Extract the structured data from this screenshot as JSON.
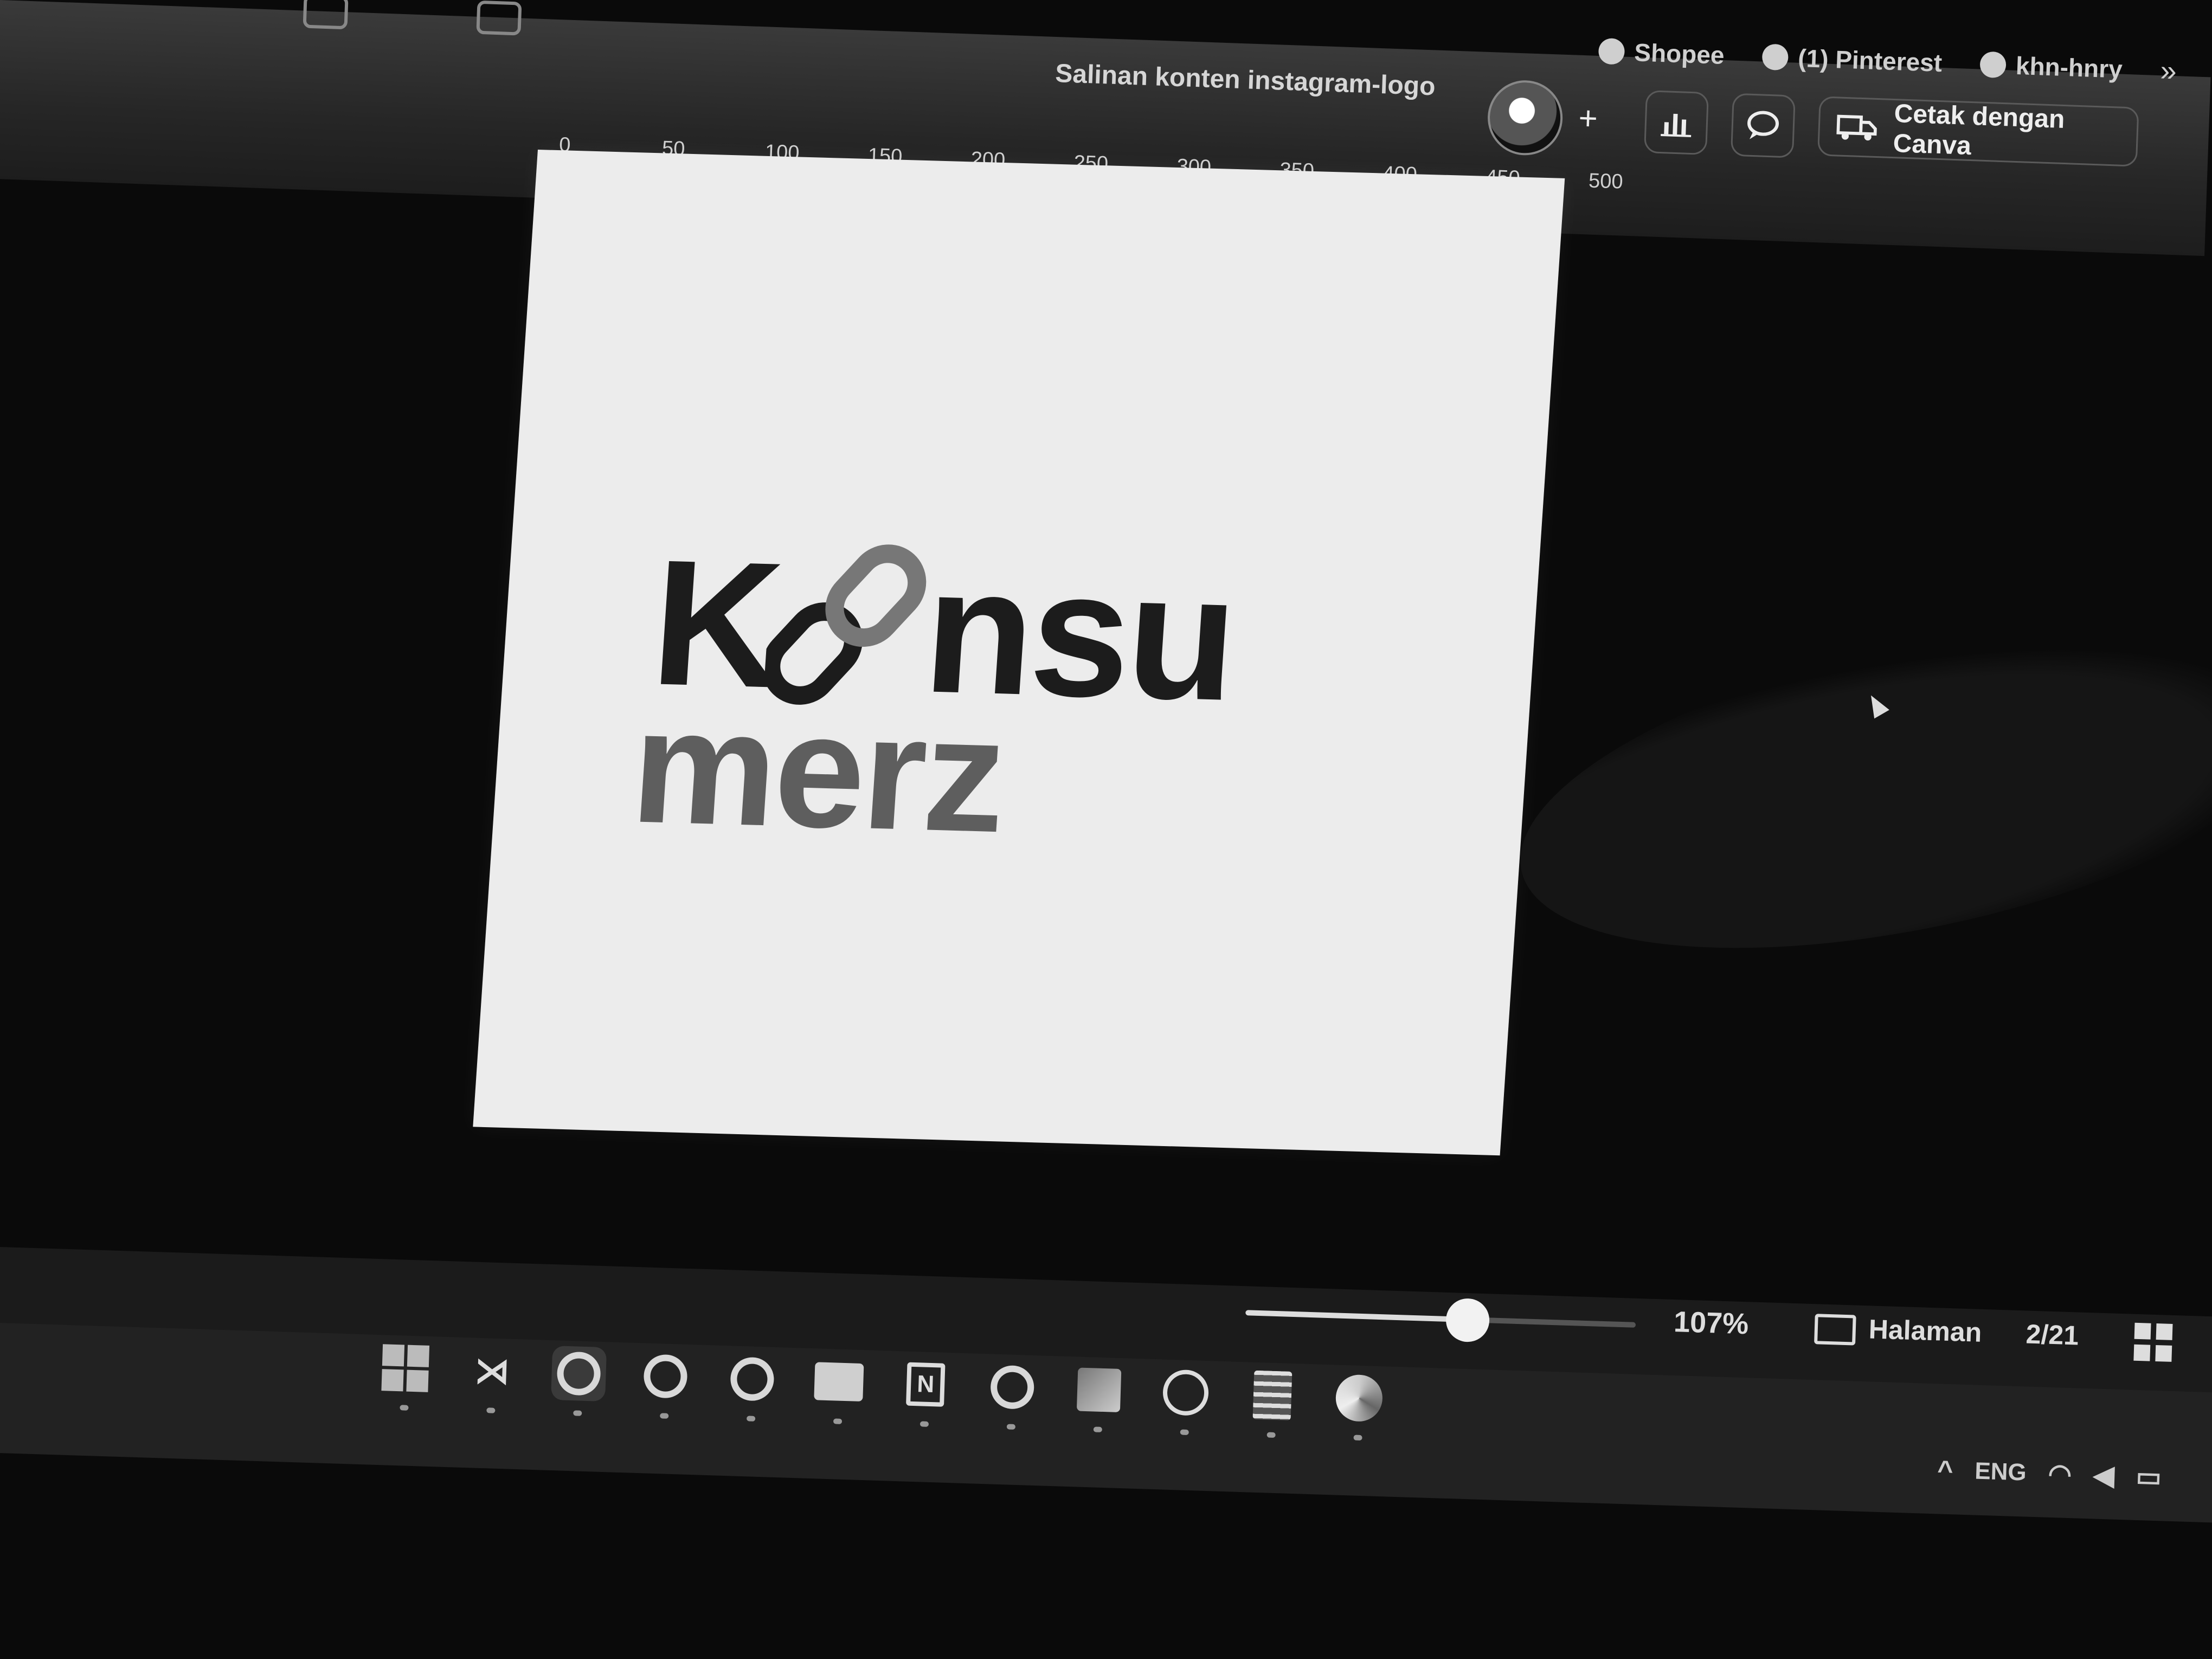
{
  "header": {
    "document_title": "Salinan konten instagram-logo",
    "print_button_label": "Cetak dengan Canva",
    "add_label": "+"
  },
  "bookmarks": [
    {
      "label": "Shopee"
    },
    {
      "label": "(1) Pinterest"
    },
    {
      "label": "khn-hnry"
    }
  ],
  "ruler": {
    "labels": [
      "0",
      "50",
      "100",
      "150",
      "200",
      "250",
      "300",
      "350",
      "400",
      "450",
      "500"
    ]
  },
  "design": {
    "logo_line1_k": "K",
    "logo_line1_rest": "nsu",
    "logo_line2": "merz"
  },
  "footer": {
    "zoom_level": "107%",
    "zoom_fraction": 0.57,
    "pages_label": "Halaman",
    "page_count": "2/21"
  },
  "taskbar": {
    "apps": [
      "windows-start",
      "vscode",
      "canva",
      "canva",
      "canva",
      "file-explorer",
      "notion",
      "canva",
      "photos",
      "whatsapp",
      "notepad",
      "edge"
    ]
  },
  "system_tray": {
    "language": "ENG"
  }
}
